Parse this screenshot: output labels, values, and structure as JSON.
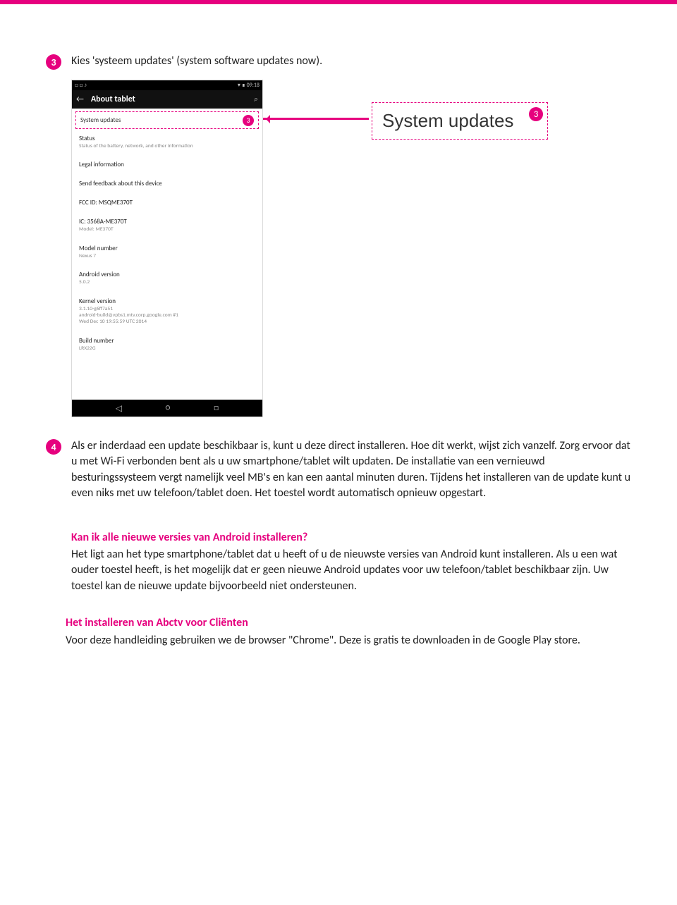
{
  "step3": {
    "num": "3",
    "text": "Kies 'systeem updates' (system software updates now)."
  },
  "tablet": {
    "status_left": "□ □ ♪",
    "status_right": "▾ ∎ 09:18",
    "header": {
      "arrow": "←",
      "title": "About tablet",
      "search": "⌕"
    },
    "highlight": {
      "label": "System updates",
      "badge": "3"
    },
    "items": [
      {
        "label": "Status",
        "sub": "Status of the battery, network, and other information"
      },
      {
        "label": "Legal information",
        "sub": ""
      },
      {
        "label": "Send feedback about this device",
        "sub": ""
      },
      {
        "label": "FCC ID: MSQME370T",
        "sub": ""
      },
      {
        "label": "IC: 3568A-ME370T",
        "sub": "Model: ME370T"
      },
      {
        "label": "Model number",
        "sub": "Nexus 7"
      },
      {
        "label": "Android version",
        "sub": "5.0.2"
      },
      {
        "label": "Kernel version",
        "sub": "3.1.10-g6ff7a51\nandroid-build@vpbs1.mtv.corp.google.com #1\nWed Dec 10 19:55:59 UTC 2014"
      },
      {
        "label": "Build number",
        "sub": "LRX22G"
      }
    ],
    "nav": {
      "back": "◁",
      "home": "○",
      "recent": "□"
    }
  },
  "callout": {
    "text": "System updates",
    "badge": "3"
  },
  "step4": {
    "num": "4",
    "text": "Als er inderdaad een update beschikbaar is, kunt u deze direct installeren. Hoe dit werkt, wijst zich vanzelf. Zorg ervoor dat u met Wi-Fi verbonden bent als u uw smartphone/tablet wilt updaten. De installatie van een vernieuwd besturingssysteem vergt namelijk veel MB's en kan een aantal minuten duren. Tijdens het installeren van de update kunt u even niks met uw telefoon/tablet doen. Het toestel wordt automatisch opnieuw opgestart."
  },
  "info": {
    "heading": "Kan ik alle nieuwe versies van Android installeren?",
    "body": "Het ligt aan het type smartphone/tablet dat u heeft of u de nieuwste versies van Android kunt installeren. Als u een wat ouder toestel heeft, is het mogelijk dat er geen nieuwe Android updates voor uw telefoon/tablet beschikbaar zijn. Uw toestel kan de nieuwe update bijvoorbeeld niet ondersteunen."
  },
  "install": {
    "heading": "Het installeren van Abctv voor Cliënten",
    "body": "Voor deze handleiding gebruiken we de browser \"Chrome\". Deze is gratis te downloaden in de Google Play store."
  }
}
